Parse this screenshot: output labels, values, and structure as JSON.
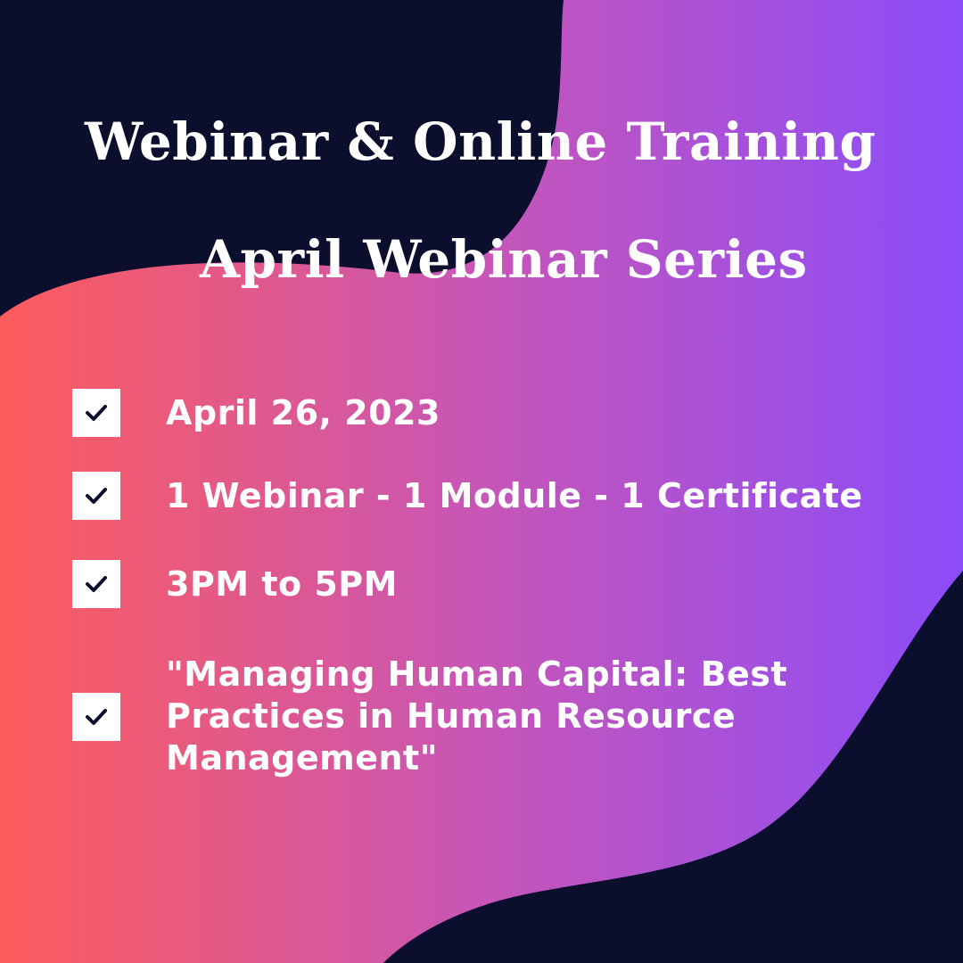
{
  "poster": {
    "title": "Webinar & Online Training",
    "subtitle": "April Webinar Series",
    "items": [
      {
        "label": "April 26, 2023",
        "icon": "checkbox-checked-icon"
      },
      {
        "label": "1 Webinar - 1 Module - 1 Certificate",
        "icon": "checkbox-checked-icon"
      },
      {
        "label": "3PM to 5PM",
        "icon": "checkbox-checked-icon"
      },
      {
        "label": "\"Managing Human Capital: Best Practices in Human Resource Management\"",
        "icon": "checkbox-checked-icon"
      }
    ]
  },
  "colors": {
    "background": "#0b0e2d",
    "gradient_start": "#fd5c5c",
    "gradient_mid": "#c756b7",
    "gradient_end": "#8b4cf9",
    "text": "#ffffff",
    "checkmark": "#0b0e2d"
  }
}
